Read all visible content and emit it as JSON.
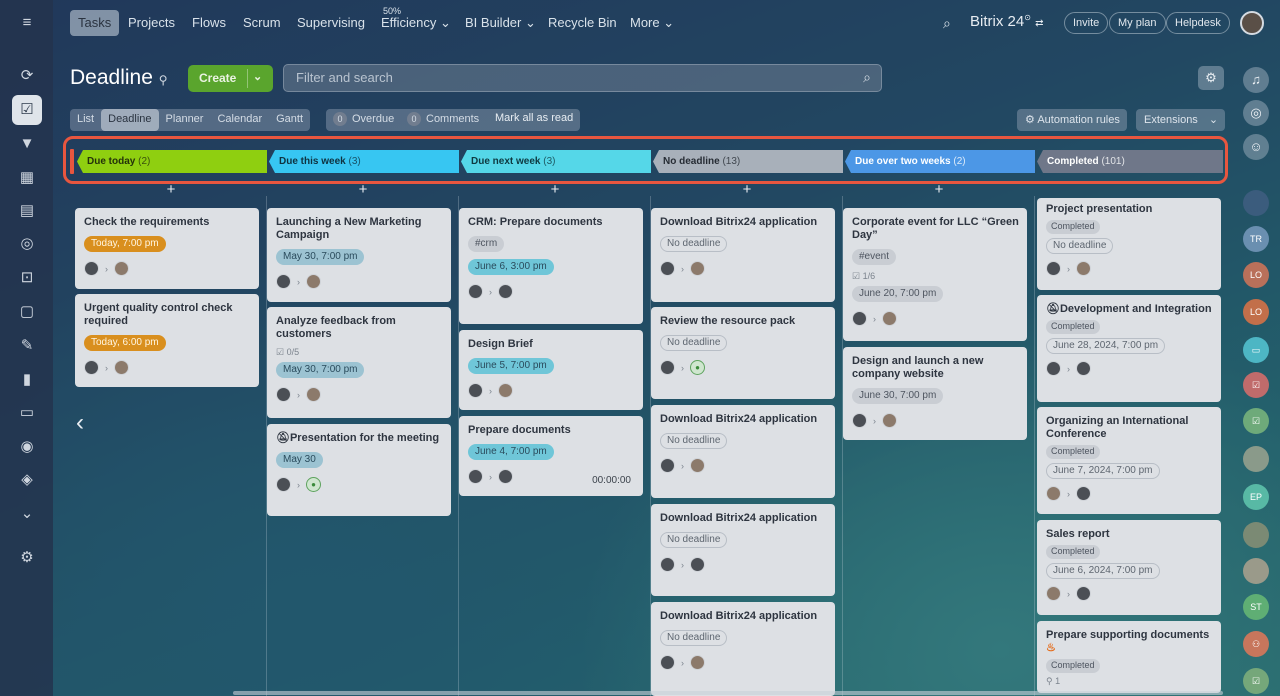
{
  "topbar": {
    "nav": [
      "Tasks",
      "Projects",
      "Flows",
      "Scrum",
      "Supervising",
      "Efficiency",
      "BI Builder",
      "Recycle Bin",
      "More"
    ],
    "efficiency_pct": "50%",
    "brand": "Bitrix 24",
    "invite": "Invite",
    "my_plan": "My plan",
    "helpdesk": "Helpdesk"
  },
  "toolbar": {
    "title": "Deadline",
    "create": "Create",
    "search_placeholder": "Filter and search",
    "views": [
      "List",
      "Deadline",
      "Planner",
      "Calendar",
      "Gantt"
    ],
    "overdue_count": "0",
    "overdue_label": "Overdue",
    "comments_count": "0",
    "comments_label": "Comments",
    "mark_read": "Mark all as read",
    "automation": "Automation rules",
    "extensions": "Extensions"
  },
  "stages": [
    {
      "label": "Due today",
      "count": "(2)",
      "color": "#8fcf10"
    },
    {
      "label": "Due this week",
      "count": "(3)",
      "color": "#37c6f2"
    },
    {
      "label": "Due next week",
      "count": "(3)",
      "color": "#55d7e8"
    },
    {
      "label": "No deadline",
      "count": "(13)",
      "color": "#a8b0ba"
    },
    {
      "label": "Due over two weeks",
      "count": "(2)",
      "color": "#4c97e6"
    },
    {
      "label": "Completed",
      "count": "(101)",
      "color": "#6f7789"
    }
  ],
  "right_rail": {
    "avatars": [
      "TR",
      "LO",
      "LO",
      "EP",
      "ST"
    ]
  },
  "cards": {
    "c0_0": {
      "title": "Check the requirements",
      "date": "Today, 7:00 pm"
    },
    "c0_1": {
      "title": "Urgent quality control check required",
      "date": "Today, 6:00 pm"
    },
    "c1_0": {
      "title": "Launching a New Marketing Campaign",
      "date": "May 30, 7:00 pm"
    },
    "c1_1": {
      "title": "Analyze feedback from customers",
      "checklist": "0/5",
      "date": "May 30, 7:00 pm"
    },
    "c1_2": {
      "title": "Presentation for the meeting",
      "date": "May 30"
    },
    "c2_0": {
      "title": "CRM: Prepare documents",
      "tag": "#crm",
      "date": "June 6, 3:00 pm"
    },
    "c2_1": {
      "title": "Design Brief",
      "date": "June 5, 7:00 pm"
    },
    "c2_2": {
      "title": "Prepare documents",
      "date": "June 4, 7:00 pm",
      "timer": "00:00:00"
    },
    "c3_0": {
      "title": "Download Bitrix24 application",
      "date": "No deadline"
    },
    "c3_1": {
      "title": "Review the resource pack",
      "date": "No deadline"
    },
    "c3_2": {
      "title": "Download Bitrix24 application",
      "date": "No deadline"
    },
    "c3_3": {
      "title": "Download Bitrix24 application",
      "date": "No deadline"
    },
    "c3_4": {
      "title": "Download Bitrix24 application",
      "date": "No deadline"
    },
    "c4_0": {
      "title": "Corporate event for LLC “Green Day”",
      "tag": "#event",
      "checklist": "1/6",
      "date": "June 20, 7:00 pm"
    },
    "c4_1": {
      "title": "Design and launch a new company website",
      "date": "June 30, 7:00 pm"
    },
    "c5_0": {
      "title": "Project presentation",
      "status": "Completed",
      "date": "No deadline"
    },
    "c5_1": {
      "title": "Development and Integration",
      "status": "Completed",
      "date": "June 28, 2024, 7:00 pm"
    },
    "c5_2": {
      "title": "Organizing an International Conference",
      "status": "Completed",
      "date": "June 7, 2024, 7:00 pm"
    },
    "c5_3": {
      "title": "Sales report",
      "status": "Completed",
      "date": "June 6, 2024, 7:00 pm"
    },
    "c5_4": {
      "title": "Prepare supporting documents",
      "status": "Completed",
      "files": "1"
    }
  }
}
